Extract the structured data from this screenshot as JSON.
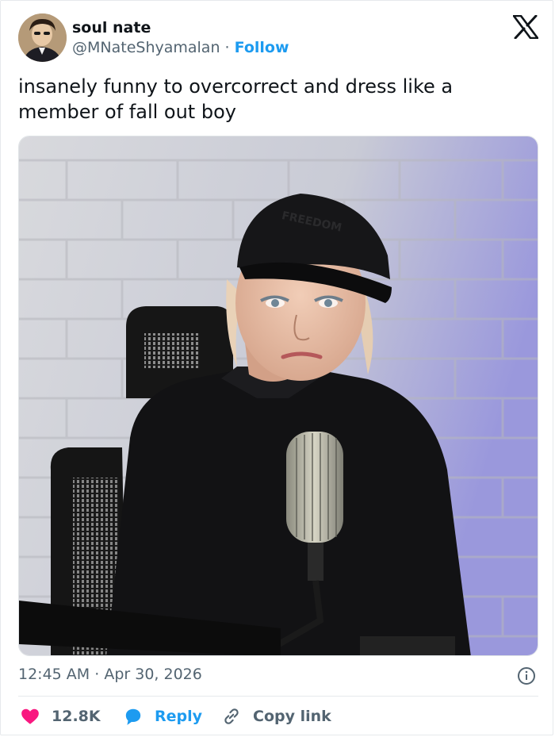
{
  "author": {
    "display_name": "soul nate",
    "handle": "@MNateShyamalan",
    "separator": "·",
    "follow_label": "Follow"
  },
  "tweet": {
    "text": "insanely funny to overcorrect and dress like a member of fall out boy",
    "cap_text": "FREEDOM"
  },
  "meta": {
    "time": "12:45 AM",
    "separator": "·",
    "date": "Apr 30, 2026"
  },
  "actions": {
    "likes": "12.8K",
    "reply_label": "Reply",
    "copy_label": "Copy link"
  },
  "icons": {
    "logo": "x-logo-icon",
    "info": "info-icon",
    "like": "heart-icon",
    "reply": "reply-bubble-icon",
    "copy": "link-icon"
  },
  "colors": {
    "accent": "#1d9bf0",
    "like": "#f91880",
    "muted": "#536471",
    "text": "#0f1419"
  }
}
